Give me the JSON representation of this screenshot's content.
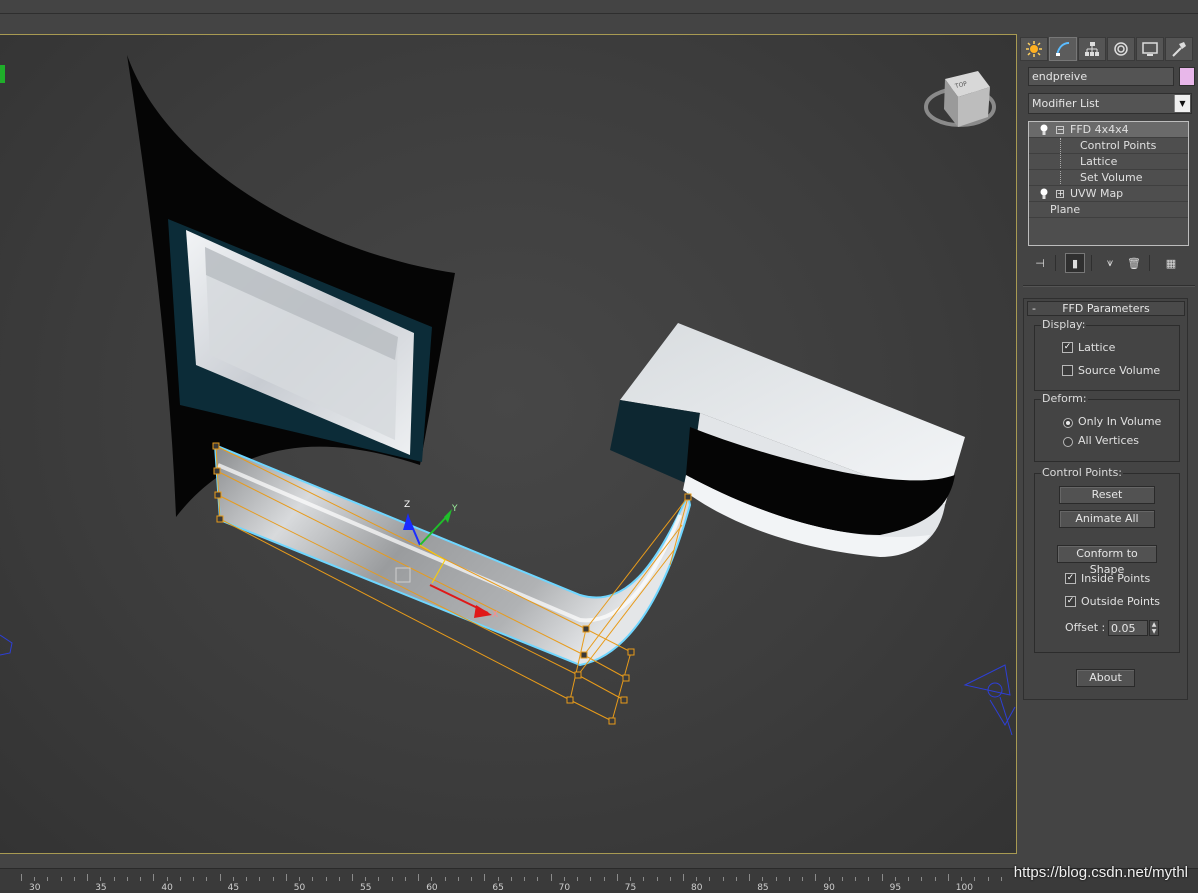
{
  "viewport": {
    "gizmo_axes": {
      "x": "X",
      "y": "Y",
      "z": "Z"
    },
    "viewcube_label": "TOP"
  },
  "command_panel": {
    "tabs": [
      "create-icon",
      "modify-icon",
      "hierarchy-icon",
      "motion-icon",
      "display-icon",
      "utilities-icon"
    ],
    "object_name": "endpreive",
    "object_color": "#e8b7ea",
    "modifier_list_label": "Modifier List",
    "stack": {
      "ffd": "FFD 4x4x4",
      "ffd_subitems": [
        "Control Points",
        "Lattice",
        "Set Volume"
      ],
      "uvw": "UVW Map",
      "base": "Plane"
    }
  },
  "ffd_parameters": {
    "title": "FFD Parameters",
    "display": {
      "label": "Display:",
      "lattice": "Lattice",
      "lattice_checked": true,
      "source_volume": "Source Volume",
      "source_volume_checked": false
    },
    "deform": {
      "label": "Deform:",
      "only_in_volume": "Only In Volume",
      "all_vertices": "All Vertices",
      "selected": "Only In Volume"
    },
    "control_points": {
      "label": "Control Points:",
      "reset": "Reset",
      "animate_all": "Animate All",
      "conform": "Conform to Shape",
      "inside_points": "Inside Points",
      "inside_checked": true,
      "outside_points": "Outside Points",
      "outside_checked": true,
      "offset_label": "Offset :",
      "offset_value": "0.05"
    },
    "about": "About"
  },
  "timeline": {
    "labels": [
      "30",
      "35",
      "40",
      "45",
      "50",
      "55",
      "60",
      "65",
      "70",
      "75",
      "80",
      "85",
      "90",
      "95",
      "100"
    ]
  },
  "watermark": "https://blog.csdn.net/mythl"
}
